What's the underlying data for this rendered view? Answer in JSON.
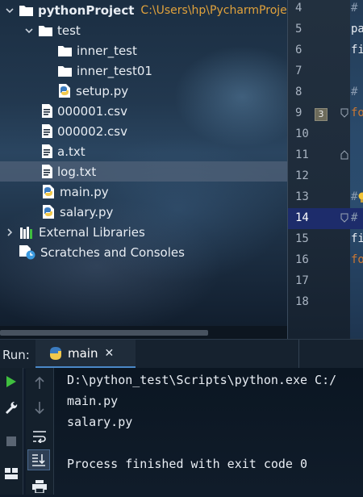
{
  "project_tree": {
    "root": {
      "name": "pythonProject",
      "path": "C:\\Users\\hp\\PycharmProje"
    },
    "items": [
      {
        "label": "test",
        "type": "folder"
      },
      {
        "label": "inner_test",
        "type": "folder"
      },
      {
        "label": "inner_test01",
        "type": "folder"
      },
      {
        "label": "setup.py",
        "type": "python-file"
      },
      {
        "label": "000001.csv",
        "type": "text-file"
      },
      {
        "label": "000002.csv",
        "type": "text-file"
      },
      {
        "label": "a.txt",
        "type": "text-file"
      },
      {
        "label": "log.txt",
        "type": "text-file",
        "selected": true
      },
      {
        "label": "main.py",
        "type": "python-file"
      },
      {
        "label": "salary.py",
        "type": "python-file"
      }
    ],
    "external_libraries": "External Libraries",
    "scratches": "Scratches and Consoles"
  },
  "editor": {
    "line_numbers": [
      "4",
      "5",
      "6",
      "7",
      "8",
      "9",
      "10",
      "11",
      "12",
      "13",
      "14",
      "15",
      "16",
      "17",
      "18"
    ],
    "current_line": "14",
    "badge": "3",
    "code_fragments": [
      {
        "line": "4",
        "text": "#"
      },
      {
        "line": "5",
        "text": "pa"
      },
      {
        "line": "6",
        "text": "fi"
      },
      {
        "line": "8",
        "text": "#"
      },
      {
        "line": "9",
        "text": "fo"
      },
      {
        "line": "13",
        "text": "#"
      },
      {
        "line": "14",
        "text": "#"
      },
      {
        "line": "15",
        "text": "fi"
      },
      {
        "line": "16",
        "text": "fo"
      }
    ]
  },
  "run_panel": {
    "label": "Run:",
    "tab_name": "main",
    "close_symbol": "✕",
    "output": [
      "D:\\python_test\\Scripts\\python.exe C:/",
      "main.py",
      "salary.py",
      "",
      "Process finished with exit code 0"
    ]
  },
  "colors": {
    "accent": "#4a88c7",
    "path_text": "#e0a23c",
    "run_green": "#3fbf3f",
    "python_blue": "#3b7bbf",
    "python_yellow": "#f2c94c",
    "keyword_orange": "#cc7832",
    "hint_yellow": "#f2c438"
  },
  "icons": [
    "chevron-down-icon",
    "chevron-right-icon",
    "folder-icon",
    "python-file-icon",
    "text-file-icon",
    "libraries-icon",
    "scratches-icon",
    "run-icon",
    "wrench-icon",
    "stop-icon",
    "layout-icon",
    "arrow-up-icon",
    "arrow-down-icon",
    "soft-wrap-icon",
    "scroll-to-end-icon",
    "print-icon",
    "close-icon",
    "bulb-icon"
  ]
}
